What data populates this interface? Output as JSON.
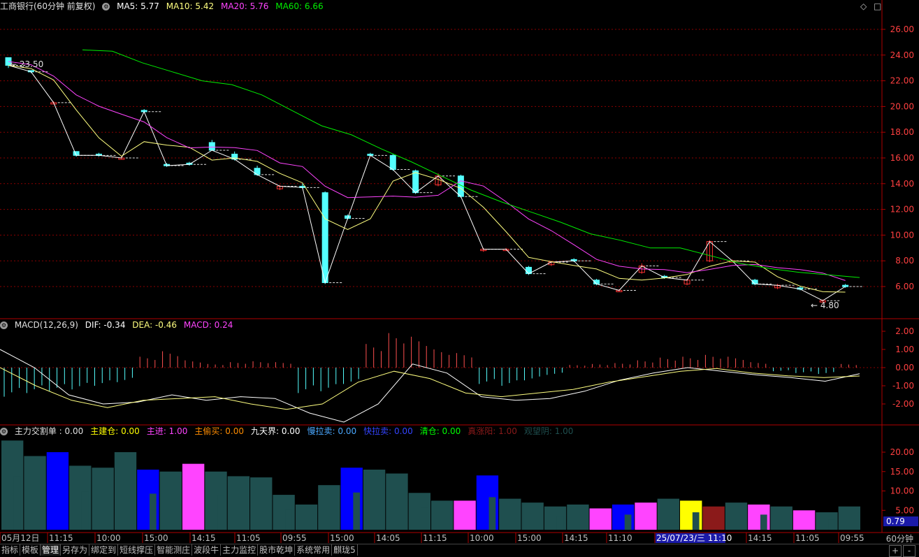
{
  "header": {
    "title": "工商银行(60分钟 前复权)",
    "ma5": "MA5: 5.77",
    "ma10": "MA10: 5.42",
    "ma20": "MA20: 5.76",
    "ma60": "MA60: 6.66",
    "controls": [
      "◇",
      "□"
    ]
  },
  "macd": {
    "label": "MACD(12,26,9)",
    "dif": "DIF: -0.34",
    "dea": "DEA: -0.46",
    "macd": "MACD: 0.24",
    "yticks": [
      "2.00",
      "1.00",
      "0.00",
      "-1.00",
      "-2.00"
    ]
  },
  "lower": {
    "labels": [
      {
        "text": "主力交割单 : 0.00",
        "color": "#e0e0e0"
      },
      {
        "text": "主建仓: 0.00",
        "color": "#ffff00"
      },
      {
        "text": "主进: 1.00",
        "color": "#ff44ff"
      },
      {
        "text": "主偷买: 0.00",
        "color": "#ff8c00"
      },
      {
        "text": "九天界: 0.00",
        "color": "#ffffff"
      },
      {
        "text": "慢拉卖: 0.00",
        "color": "#4aa8ff"
      },
      {
        "text": "快拉卖: 0.00",
        "color": "#3344ff"
      },
      {
        "text": "清仓: 0.00",
        "color": "#00ff00"
      },
      {
        "text": "真涨阳: 1.00",
        "color": "#8b1a1a"
      },
      {
        "text": "观望阴: 1.00",
        "color": "#1f4f4f"
      }
    ],
    "yticks": [
      "20.00",
      "15.00",
      "10.00",
      "5.00"
    ],
    "current": "0.79"
  },
  "price_axis": [
    "26.00",
    "24.00",
    "22.00",
    "20.00",
    "18.00",
    "16.00",
    "14.00",
    "12.00",
    "10.00",
    "8.00",
    "6.00"
  ],
  "annotations": {
    "high": "23.50",
    "low": "4.80"
  },
  "time_axis": [
    "05月12日",
    "11:15",
    "10:00",
    "15:00",
    "14:15",
    "11:05",
    "09:55",
    "15:00",
    "14:05",
    "11:15",
    "10:00",
    "15:00",
    "14:15",
    "11:10",
    "25/07/23/三 11:10",
    "14:15",
    "11:05",
    "09:55"
  ],
  "period": "60分钟",
  "tabs": [
    "指标",
    "模板",
    "管理",
    "另存为",
    "绑定到",
    "短线撑压",
    "智能测庄",
    "波段牛",
    "主力监控",
    "股市乾坤",
    "系统常用",
    "麒珑5"
  ],
  "tab_buttons": [
    "+",
    "-"
  ],
  "colors": {
    "up": "#ff3232",
    "down": "#54ffff",
    "ma5": "#ffffff",
    "ma10": "#ffff80",
    "ma20": "#ff44ff",
    "ma60": "#00ee00",
    "grid": "#8b0000"
  },
  "chart_data": {
    "type": "candlestick",
    "ohlc": [
      [
        23.8,
        23.8,
        23.0,
        23.2
      ],
      [
        22.8,
        22.8,
        22.6,
        22.7
      ],
      [
        20.3,
        20.4,
        20.2,
        20.3
      ],
      [
        16.5,
        16.5,
        16.1,
        16.2
      ],
      [
        16.3,
        16.4,
        16.1,
        16.2
      ],
      [
        16.0,
        16.1,
        15.9,
        16.0
      ],
      [
        19.7,
        19.8,
        19.5,
        19.6
      ],
      [
        15.5,
        15.6,
        15.3,
        15.4
      ],
      [
        15.6,
        15.7,
        15.4,
        15.5
      ],
      [
        17.2,
        17.4,
        16.6,
        16.6
      ],
      [
        16.3,
        16.5,
        15.8,
        15.9
      ],
      [
        15.2,
        15.4,
        14.6,
        14.7
      ],
      [
        13.6,
        13.9,
        13.5,
        13.8
      ],
      [
        13.8,
        14.0,
        13.6,
        13.7
      ],
      [
        13.3,
        13.4,
        6.2,
        6.3
      ],
      [
        11.5,
        11.6,
        11.2,
        11.3
      ],
      [
        16.3,
        16.4,
        16.2,
        16.2
      ],
      [
        16.2,
        16.3,
        15.0,
        15.1
      ],
      [
        15.0,
        15.1,
        13.2,
        13.3
      ],
      [
        13.9,
        14.8,
        13.8,
        14.6
      ],
      [
        14.6,
        14.7,
        12.9,
        13.0
      ],
      [
        8.8,
        9.0,
        8.7,
        8.9
      ],
      [
        8.9,
        9.0,
        8.8,
        8.9
      ],
      [
        7.5,
        7.6,
        6.9,
        7.0
      ],
      [
        7.7,
        8.0,
        7.6,
        7.9
      ],
      [
        8.1,
        8.2,
        7.9,
        8.0
      ],
      [
        6.5,
        6.6,
        6.1,
        6.2
      ],
      [
        5.7,
        5.8,
        5.6,
        5.7
      ],
      [
        7.1,
        7.8,
        7.0,
        7.6
      ],
      [
        6.8,
        6.9,
        6.6,
        6.7
      ],
      [
        6.2,
        6.6,
        6.1,
        6.5
      ],
      [
        8.0,
        9.6,
        7.9,
        9.5
      ],
      [
        8.0,
        8.1,
        7.9,
        8.0
      ],
      [
        6.5,
        6.6,
        6.1,
        6.2
      ],
      [
        5.9,
        6.2,
        5.8,
        6.1
      ],
      [
        5.9,
        6.0,
        5.7,
        5.8
      ],
      [
        4.9,
        5.0,
        4.8,
        4.9
      ],
      [
        6.1,
        6.2,
        5.9,
        6.0
      ]
    ],
    "ma60": [
      24.4,
      24.3,
      23.4,
      22.7,
      22.0,
      21.7,
      20.9,
      19.7,
      18.5,
      17.8,
      16.7,
      15.7,
      14.6,
      13.5,
      12.6,
      11.8,
      11.0,
      10.1,
      9.6,
      9.0,
      9.0,
      8.4,
      7.8,
      7.4,
      7.1,
      6.9,
      6.7
    ],
    "macd_hist": [
      -1.6,
      -1.4,
      -1.3,
      -1.2,
      -1.0,
      -0.8,
      0.6,
      0.9,
      0.4,
      0.2,
      0.3,
      0.35,
      0.3,
      -1.4,
      -1.3,
      -0.9,
      1.3,
      1.9,
      1.7,
      1.0,
      0.8,
      -0.9,
      -1.0,
      -0.7,
      -0.4,
      0.15,
      0.2,
      0.25,
      0.4,
      0.55,
      0.6,
      0.7,
      0.6,
      0.3,
      -0.2,
      -0.3,
      -0.35,
      0.2
    ],
    "dif": [
      1.0,
      0.0,
      -1.5,
      -2.0,
      -1.9,
      -1.5,
      -1.8,
      -1.6,
      -1.7,
      -2.5,
      -3.0,
      -2.0,
      0.2,
      -0.3,
      -1.6,
      -1.8,
      -1.7,
      -1.3,
      -0.7,
      -0.3,
      0.0,
      -0.2,
      -0.4,
      -0.55,
      -0.75,
      -0.34
    ],
    "dea": [
      0.0,
      -1.0,
      -1.8,
      -2.2,
      -1.8,
      -1.7,
      -1.6,
      -2.0,
      -2.3,
      -2.0,
      -0.8,
      -0.2,
      -0.6,
      -1.4,
      -1.6,
      -1.4,
      -1.2,
      -0.8,
      -0.5,
      -0.2,
      -0.05,
      -0.3,
      -0.45,
      -0.55,
      -0.46
    ],
    "lower_bars": [
      {
        "v": 23.0,
        "c": "#1f4f4f"
      },
      {
        "v": 19.0,
        "c": "#1f4f4f"
      },
      {
        "v": 20.0,
        "c": "#0000ff"
      },
      {
        "v": 16.5,
        "c": "#1f4f4f"
      },
      {
        "v": 16.0,
        "c": "#1f4f4f"
      },
      {
        "v": 20.0,
        "c": "#1f4f4f"
      },
      {
        "v": 15.5,
        "c": "#0000ff"
      },
      {
        "v": 15.0,
        "c": "#1f4f4f"
      },
      {
        "v": 17.0,
        "c": "#ff44ff"
      },
      {
        "v": 15.0,
        "c": "#1f4f4f"
      },
      {
        "v": 13.8,
        "c": "#1f4f4f"
      },
      {
        "v": 13.5,
        "c": "#1f4f4f"
      },
      {
        "v": 9.0,
        "c": "#1f4f4f"
      },
      {
        "v": 6.5,
        "c": "#1f4f4f"
      },
      {
        "v": 11.5,
        "c": "#1f4f4f"
      },
      {
        "v": 16.0,
        "c": "#0000ff"
      },
      {
        "v": 15.5,
        "c": "#1f4f4f"
      },
      {
        "v": 14.5,
        "c": "#1f4f4f"
      },
      {
        "v": 9.5,
        "c": "#1f4f4f"
      },
      {
        "v": 7.5,
        "c": "#1f4f4f"
      },
      {
        "v": 7.5,
        "c": "#ff44ff"
      },
      {
        "v": 14.0,
        "c": "#0000ff"
      },
      {
        "v": 8.0,
        "c": "#1f4f4f"
      },
      {
        "v": 7.0,
        "c": "#1f4f4f"
      },
      {
        "v": 6.0,
        "c": "#1f4f4f"
      },
      {
        "v": 6.5,
        "c": "#1f4f4f"
      },
      {
        "v": 5.5,
        "c": "#ff44ff"
      },
      {
        "v": 6.5,
        "c": "#0000ff"
      },
      {
        "v": 7.0,
        "c": "#ff44ff"
      },
      {
        "v": 8.0,
        "c": "#1f4f4f"
      },
      {
        "v": 7.5,
        "c": "#ffff00"
      },
      {
        "v": 6.0,
        "c": "#8b1a1a"
      },
      {
        "v": 7.0,
        "c": "#1f4f4f"
      },
      {
        "v": 6.5,
        "c": "#ff44ff"
      },
      {
        "v": 6.0,
        "c": "#1f4f4f"
      },
      {
        "v": 5.0,
        "c": "#ff44ff"
      },
      {
        "v": 4.5,
        "c": "#1f4f4f"
      },
      {
        "v": 6.0,
        "c": "#1f4f4f"
      }
    ]
  }
}
